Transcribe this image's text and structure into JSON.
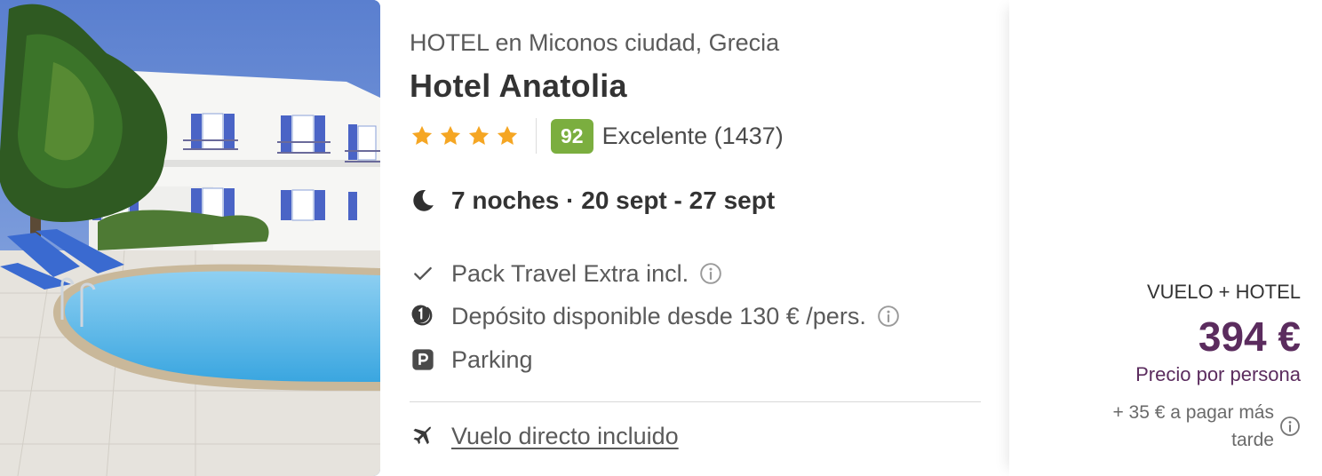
{
  "hotel": {
    "category_line": "HOTEL en Miconos ciudad, Grecia",
    "name": "Hotel Anatolia",
    "stars": 4,
    "score": "92",
    "score_text": "Excelente (1437)"
  },
  "stay": {
    "duration": "7 noches · 20 sept - 27 sept"
  },
  "features": [
    {
      "icon": "check-icon",
      "label": "Pack Travel Extra incl.",
      "has_info": true
    },
    {
      "icon": "deposit-icon",
      "label": "Depósito disponible desde 130 € /pers.",
      "has_info": true
    },
    {
      "icon": "parking-icon",
      "label": "Parking",
      "has_info": false
    }
  ],
  "flight": {
    "icon": "plane-icon",
    "label": "Vuelo directo incluido"
  },
  "price": {
    "type": "VUELO + HOTEL",
    "amount": "394 €",
    "note": "Precio por persona",
    "extra": "+ 35 € a pagar más tarde"
  },
  "colors": {
    "score_badge": "#7bae3f",
    "star": "#f5a623",
    "price": "#5b2c5e",
    "text": "#333333",
    "muted": "#5a5a5a"
  }
}
